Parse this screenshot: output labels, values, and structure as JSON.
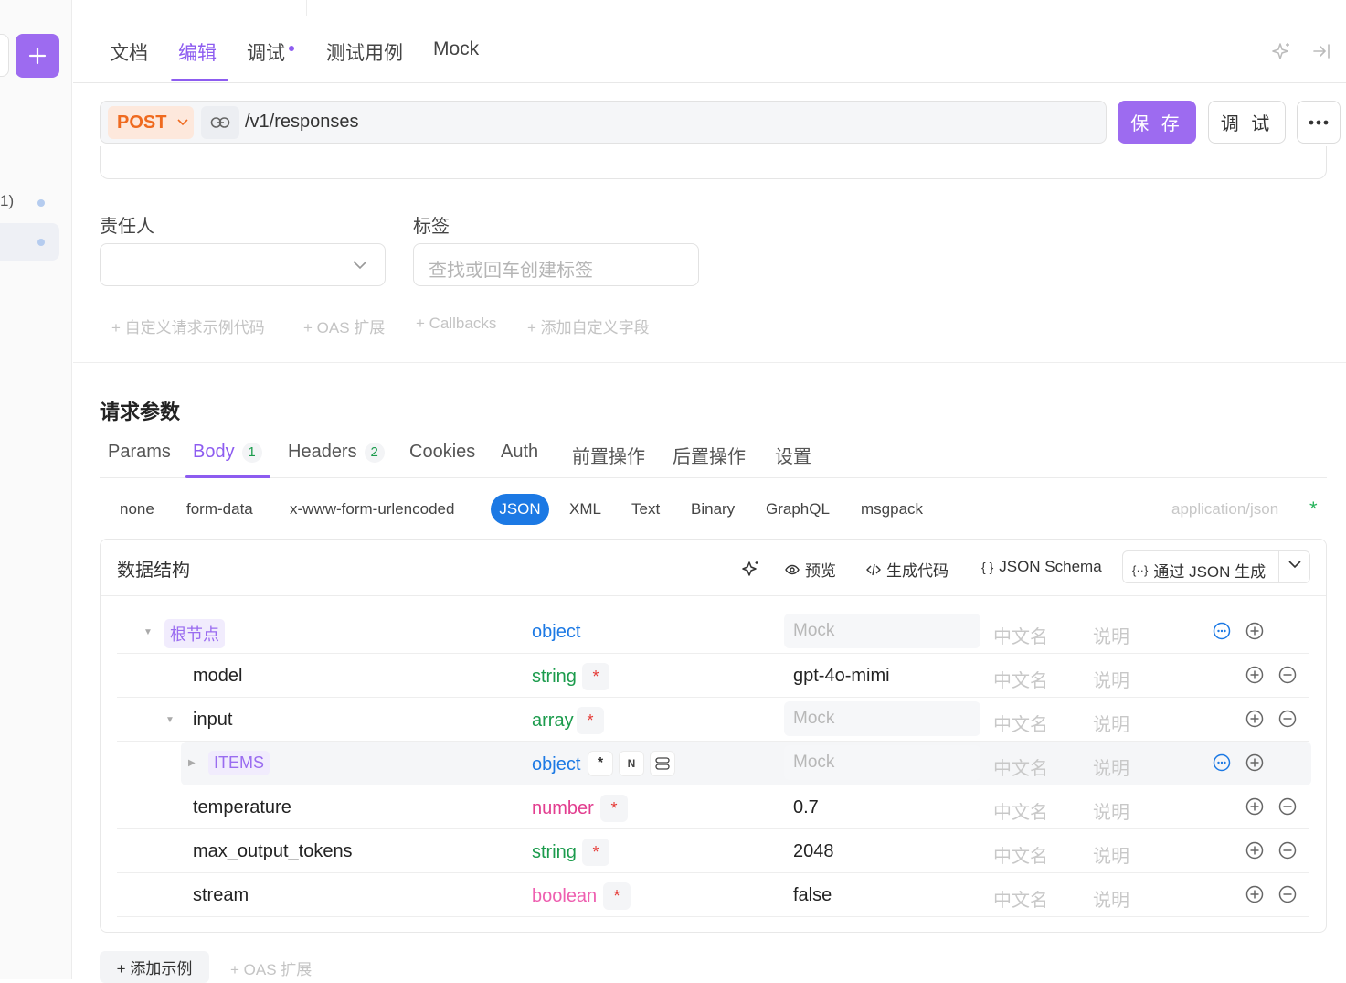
{
  "rail": {
    "partial_text": "1)"
  },
  "tabs": [
    {
      "label": "文档"
    },
    {
      "label": "编辑"
    },
    {
      "label": "调试"
    },
    {
      "label": "测试用例"
    },
    {
      "label": "Mock"
    }
  ],
  "url": {
    "method": "POST",
    "path": "/v1/responses"
  },
  "buttons": {
    "save": "保 存",
    "debug": "调 试"
  },
  "fields": {
    "owner_label": "责任人",
    "tags_label": "标签",
    "tags_placeholder": "查找或回车创建标签"
  },
  "extensions": [
    "+ 自定义请求示例代码",
    "+ OAS 扩展",
    "+ Callbacks",
    "+ 添加自定义字段"
  ],
  "request": {
    "title": "请求参数",
    "tabs": [
      {
        "label": "Params"
      },
      {
        "label": "Body",
        "count": "1"
      },
      {
        "label": "Headers",
        "count": "2"
      },
      {
        "label": "Cookies"
      },
      {
        "label": "Auth"
      },
      {
        "label": "前置操作"
      },
      {
        "label": "后置操作"
      },
      {
        "label": "设置"
      }
    ],
    "body_types": [
      "none",
      "form-data",
      "x-www-form-urlencoded",
      "JSON",
      "XML",
      "Text",
      "Binary",
      "GraphQL",
      "msgpack"
    ],
    "active_body_type": "JSON",
    "content_type": "application/json",
    "required_star": "*"
  },
  "schema": {
    "title": "数据结构",
    "actions": {
      "preview": "预览",
      "gen_code": "生成代码",
      "json_schema": "JSON Schema",
      "gen_from_json": "通过 JSON 生成"
    },
    "mock_placeholder": "Mock",
    "cn_placeholder": "中文名",
    "desc_placeholder": "说明",
    "required_mark": "*",
    "n_badge": "N",
    "rows": [
      {
        "name": "根节点",
        "type": "object",
        "value": ""
      },
      {
        "name": "model",
        "type": "string",
        "value": "gpt-4o-mimi"
      },
      {
        "name": "input",
        "type": "array",
        "value": ""
      },
      {
        "name": "ITEMS",
        "type": "object",
        "value": ""
      },
      {
        "name": "temperature",
        "type": "number",
        "value": "0.7"
      },
      {
        "name": "max_output_tokens",
        "type": "string",
        "value": "2048"
      },
      {
        "name": "stream",
        "type": "boolean",
        "value": "false"
      }
    ]
  },
  "bottom": {
    "add_example": "+ 添加示例",
    "oas_ext": "+ OAS 扩展"
  },
  "colors": {
    "accent": "#8d5cf0",
    "method": "#ef6a1f",
    "string": "#1b9b4c",
    "object": "#1c79e4",
    "number": "#e23d8f",
    "boolean": "#ee5fb0",
    "json_pill": "#1c79e4"
  }
}
